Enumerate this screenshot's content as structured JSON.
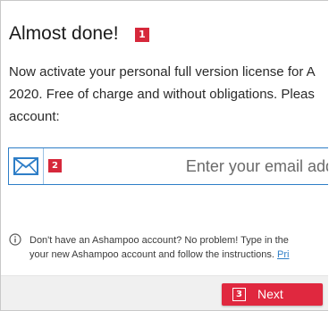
{
  "header": {
    "title": "Almost done!",
    "title_badge": "1"
  },
  "description": {
    "line1": "Now activate your personal full version license for A",
    "line2": "2020. Free of charge and without obligations. Pleas",
    "line3": "account:"
  },
  "email": {
    "icon": "mail-icon",
    "badge": "2",
    "placeholder": "Enter your email addr",
    "value": ""
  },
  "info": {
    "icon": "info-icon",
    "line1": "Don't have an Ashampoo account? No problem! Type in the",
    "line2_prefix": "your new Ashampoo account and follow the instructions. ",
    "line2_link": "Pri"
  },
  "footer": {
    "next_badge": "3",
    "next_label": "Next"
  },
  "colors": {
    "accent_red": "#e0283f",
    "link_blue": "#2e7ec7"
  }
}
